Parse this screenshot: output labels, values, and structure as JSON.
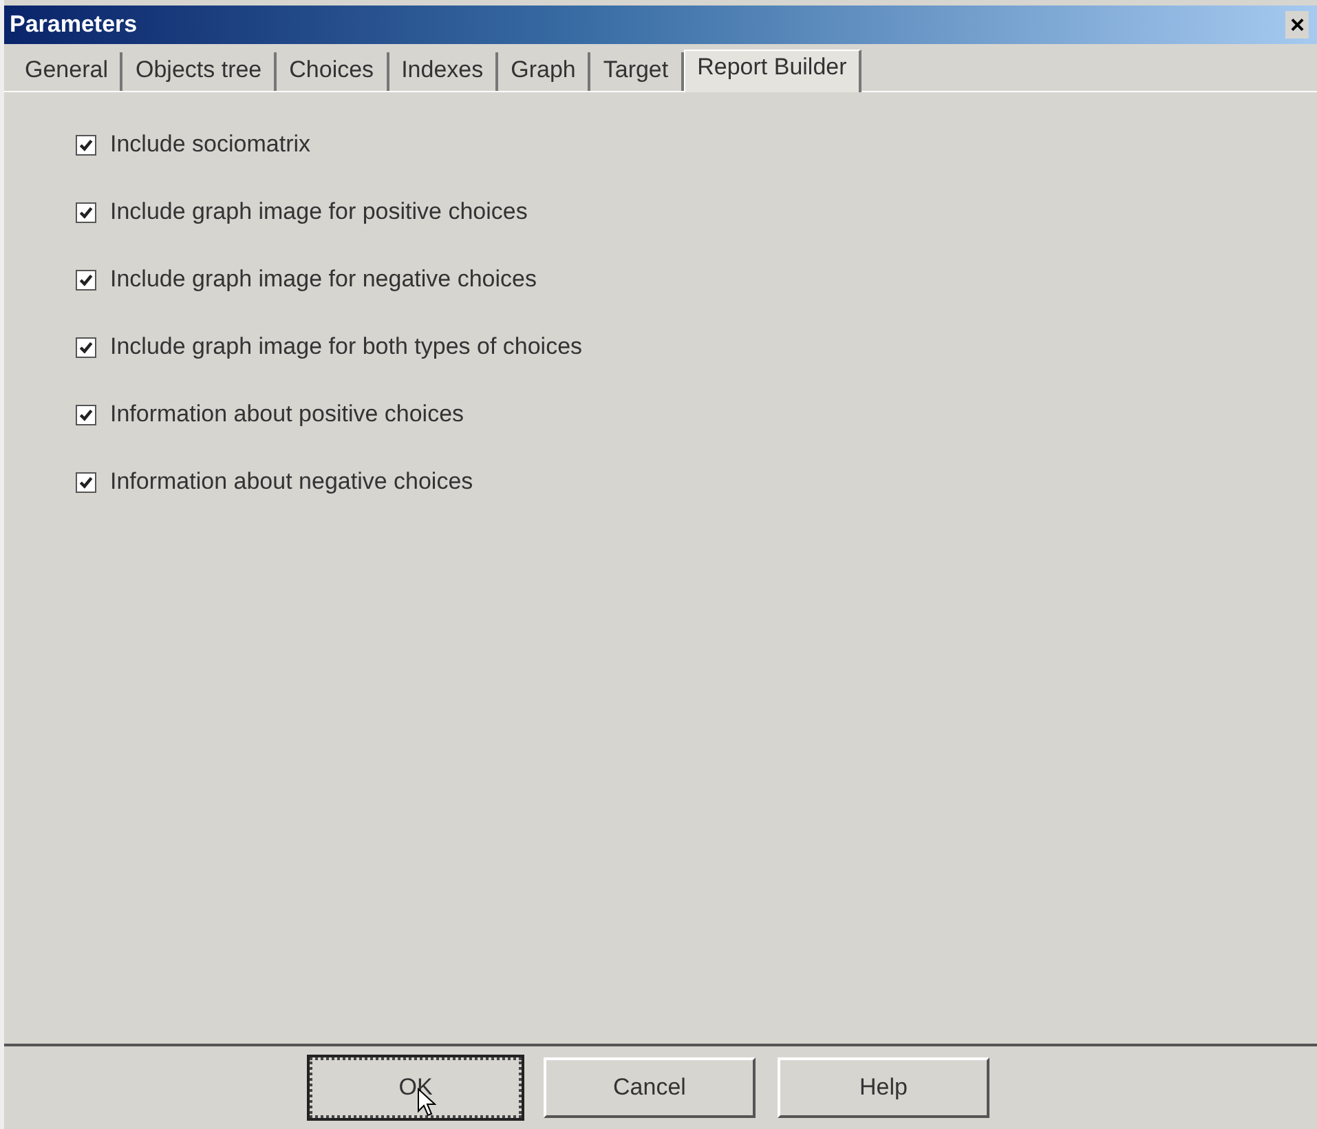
{
  "window": {
    "title": "Parameters",
    "close": "×"
  },
  "tabs": [
    {
      "label": "General",
      "selected": false
    },
    {
      "label": "Objects tree",
      "selected": false
    },
    {
      "label": "Choices",
      "selected": false
    },
    {
      "label": "Indexes",
      "selected": false
    },
    {
      "label": "Graph",
      "selected": false
    },
    {
      "label": "Target",
      "selected": false
    },
    {
      "label": "Report Builder",
      "selected": true
    }
  ],
  "options": [
    {
      "label": "Include sociomatrix",
      "checked": true
    },
    {
      "label": "Include graph image for positive choices",
      "checked": true
    },
    {
      "label": "Include graph image for negative choices",
      "checked": true
    },
    {
      "label": "Include graph image for both types of choices",
      "checked": true
    },
    {
      "label": "Information about positive choices",
      "checked": true
    },
    {
      "label": "Information about negative choices",
      "checked": true
    }
  ],
  "buttons": [
    {
      "label": "OK",
      "default": true
    },
    {
      "label": "Cancel",
      "default": false
    },
    {
      "label": "Help",
      "default": false
    }
  ]
}
